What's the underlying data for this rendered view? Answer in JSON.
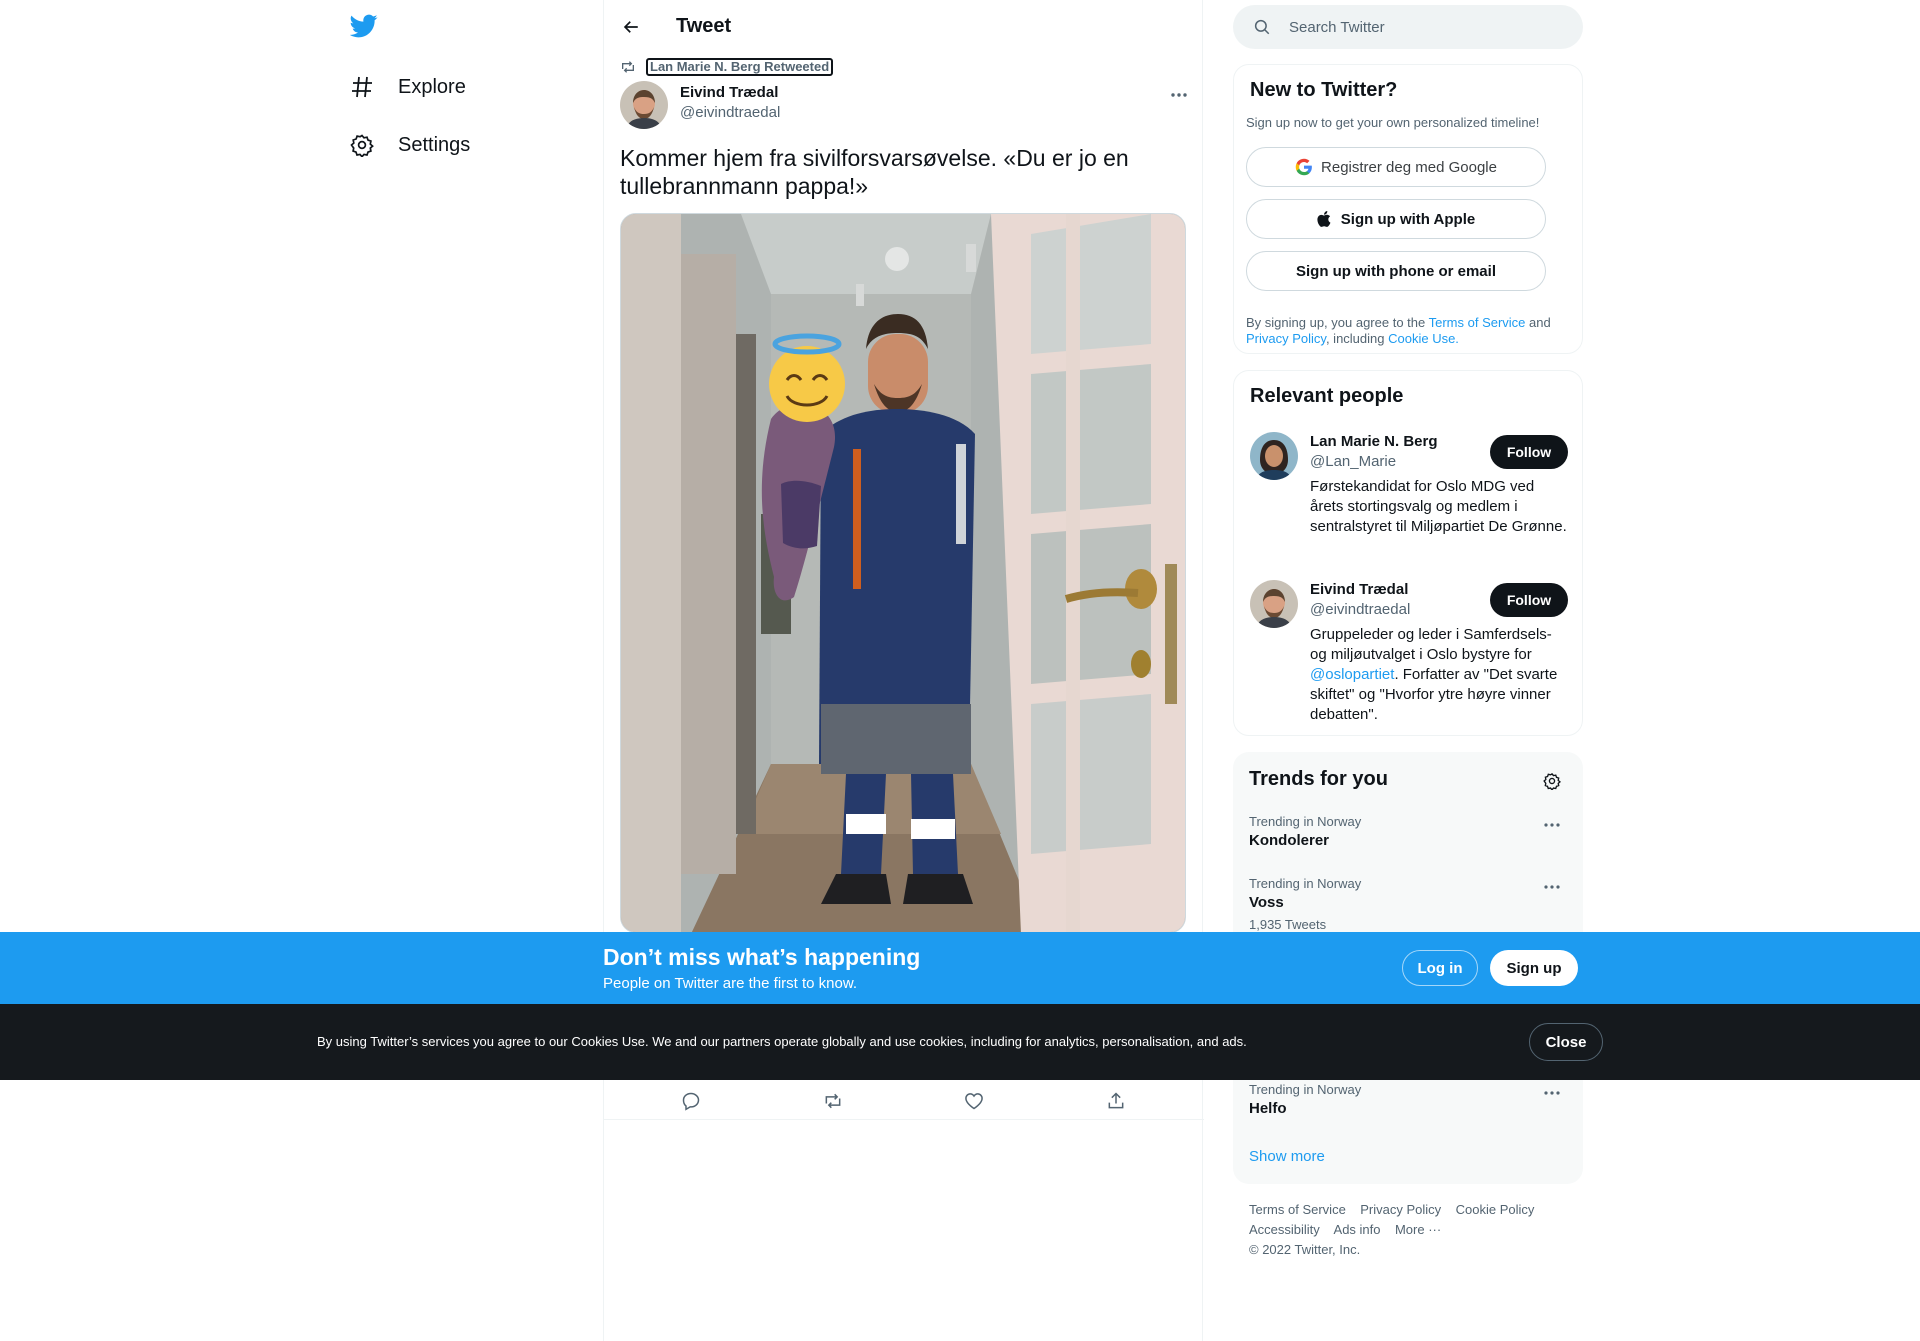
{
  "colors": {
    "brand": "#1d9bf0",
    "text": "#0f1419",
    "muted": "#536471",
    "cookie_bg": "#15191d"
  },
  "nav": {
    "logo_icon": "twitter-bird-icon",
    "items": [
      {
        "label": "Explore",
        "icon": "hashtag-icon"
      },
      {
        "label": "Settings",
        "icon": "gear-icon"
      }
    ]
  },
  "main": {
    "header_title": "Tweet",
    "retweet_label": "Lan Marie N. Berg Retweeted",
    "author": {
      "name": "Eivind Trædal",
      "handle": "@eivindtraedal"
    },
    "tweet_text": "Kommer hjem fra sivilforsvarsøvelse. «Du er jo en tullebrannmann pappa!»",
    "media_emoji": "😇",
    "actions": [
      "reply-icon",
      "retweet-icon",
      "like-icon",
      "share-icon"
    ]
  },
  "search": {
    "placeholder": "Search Twitter"
  },
  "new_to_twitter": {
    "title": "New to Twitter?",
    "subtitle": "Sign up now to get your own personalized timeline!",
    "google_btn": "Registrer deg med Google",
    "apple_btn": "Sign up with Apple",
    "phone_btn": "Sign up with phone or email",
    "legal": {
      "p1": "By signing up, you agree to the ",
      "tos": "Terms of Service",
      "p2": " and ",
      "privacy": "Privacy Policy",
      "p3": ", including ",
      "cookie": "Cookie Use."
    }
  },
  "relevant": {
    "title": "Relevant people",
    "people": [
      {
        "name": "Lan Marie N. Berg",
        "handle": "@Lan_Marie",
        "follow": "Follow",
        "bio": "Førstekandidat for Oslo MDG ved årets stortingsvalg og medlem i sentralstyret til Miljøpartiet De Grønne."
      },
      {
        "name": "Eivind Trædal",
        "handle": "@eivindtraedal",
        "follow": "Follow",
        "bio_pre": "Gruppeleder og leder i Samferdsels- og miljøutvalget i Oslo bystyre for ",
        "bio_mention": "@oslopartiet",
        "bio_post": ". Forfatter av \"Det svarte skiftet\" og \"Hvorfor ytre høyre vinner debatten\"."
      }
    ]
  },
  "trends": {
    "title": "Trends for you",
    "items": [
      {
        "context": "Trending in Norway",
        "name": "Kondolerer",
        "count": ""
      },
      {
        "context": "Trending in Norway",
        "name": "Voss",
        "count": "1,935 Tweets"
      },
      {
        "context": "Trending in Norway",
        "name": "Helfo",
        "count": ""
      }
    ],
    "show_more": "Show more"
  },
  "footer": {
    "links": [
      "Terms of Service",
      "Privacy Policy",
      "Cookie Policy",
      "Accessibility",
      "Ads info",
      "More ···"
    ],
    "copyright": "© 2022 Twitter, Inc."
  },
  "banner": {
    "title": "Don’t miss what’s happening",
    "subtitle": "People on Twitter are the first to know.",
    "login": "Log in",
    "signup": "Sign up"
  },
  "cookie": {
    "text": "By using Twitter’s services you agree to our Cookies Use. We and our partners operate globally and use cookies, including for analytics, personalisation, and ads.",
    "close": "Close"
  }
}
